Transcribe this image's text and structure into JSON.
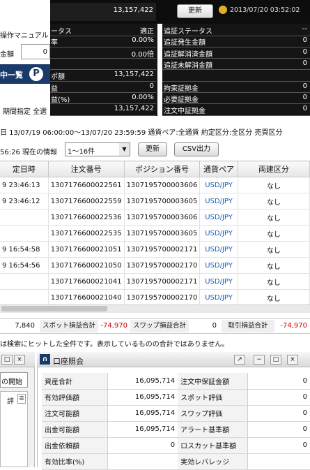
{
  "top": {
    "value_a": "13,157,422",
    "refresh": "更新",
    "datetime": "2013/07/20 03:52:02",
    "menu_manual": "操作マニュアル",
    "amount_label": "金額",
    "amount_value": "0",
    "list_btn": "中一覧",
    "p_badge": "P",
    "period": "期間指定 全選"
  },
  "status": {
    "rows": [
      {
        "label": "ータス",
        "value": "適正"
      },
      {
        "label": "率",
        "value": "0.00%"
      },
      {
        "label": "",
        "value": "0.00倍"
      },
      {
        "label": "",
        "value": ""
      },
      {
        "label": "ポ額",
        "value": "13,157,422"
      },
      {
        "label": "益",
        "value": "0"
      },
      {
        "label": "益(%)",
        "value": "0.00%"
      },
      {
        "label": "",
        "value": "13,157,422"
      }
    ]
  },
  "right_status": {
    "rows": [
      {
        "label": "追証ステータス",
        "value": "--"
      },
      {
        "label": "追証発生金額",
        "value": "0"
      },
      {
        "label": "追証解消済金額",
        "value": "0"
      },
      {
        "label": "追証未解消金額",
        "value": "0"
      },
      {
        "label": "",
        "value": ""
      },
      {
        "label": "拘束証拠金",
        "value": "0"
      },
      {
        "label": "必要証拠金",
        "value": "0"
      },
      {
        "label": "注文中証拠金",
        "value": "0"
      }
    ]
  },
  "filter": {
    "text": "日 13/07/19 06:00:00〜13/07/20 23:59:59 通貨ペア:全通貨 約定区分:全区分 売買区分",
    "info": "56:26 現在の情報",
    "select": "1〜16件",
    "refresh": "更新",
    "csv": "CSV出力"
  },
  "table": {
    "headers": [
      "定日時",
      "注文番号",
      "ポジション番号",
      "通貨ペア",
      "両建区分"
    ],
    "rows": [
      [
        "9 23:46:13",
        "1307176600022561",
        "1307195700003606",
        "USD/JPY",
        "なし"
      ],
      [
        "9 23:46:12",
        "1307176600022559",
        "1307195700003605",
        "USD/JPY",
        "なし"
      ],
      [
        "",
        "1307176600022536",
        "1307195700003606",
        "USD/JPY",
        "なし"
      ],
      [
        "",
        "1307176600022535",
        "1307195700003605",
        "USD/JPY",
        "なし"
      ],
      [
        "9 16:54:58",
        "1307176600021051",
        "1307195700002171",
        "USD/JPY",
        "なし"
      ],
      [
        "9 16:54:56",
        "1307176600021050",
        "1307195700002170",
        "USD/JPY",
        "なし"
      ],
      [
        "",
        "1307176600021041",
        "1307195700002171",
        "USD/JPY",
        "なし"
      ],
      [
        "",
        "1307176600021040",
        "1307195700002170",
        "USD/JPY",
        "なし"
      ]
    ]
  },
  "totals": {
    "v1": "7,840",
    "spot_label": "スポット損益合計",
    "spot_value": "-74,970",
    "swap_label": "スワップ損益合計",
    "swap_value": "0",
    "trade_label": "取引損益合計",
    "trade_value": "-74,970",
    "note": "は検索にヒットした全件です。表示しているものの合計ではありません。"
  },
  "left_panel": {
    "start": "の開始",
    "item": "評"
  },
  "account": {
    "title": "口座照会",
    "left": [
      {
        "label": "資産合計",
        "value": "16,095,714"
      },
      {
        "label": "有効評価額",
        "value": "16,095,714"
      },
      {
        "label": "注文可能額",
        "value": "16,095,714"
      },
      {
        "label": "出金可能額",
        "value": "16,095,714"
      },
      {
        "label": "出金依頼額",
        "value": "0"
      },
      {
        "label": "有効比率(%)",
        "value": ""
      }
    ],
    "right": [
      {
        "label": "注文中保証金額",
        "value": "0"
      },
      {
        "label": "スポット評価",
        "value": "0"
      },
      {
        "label": "スワップ評価",
        "value": "0"
      },
      {
        "label": "アラート基準額",
        "value": "0"
      },
      {
        "label": "ロスカット基準額",
        "value": "0"
      },
      {
        "label": "実効レバレッジ",
        "value": ""
      }
    ]
  }
}
